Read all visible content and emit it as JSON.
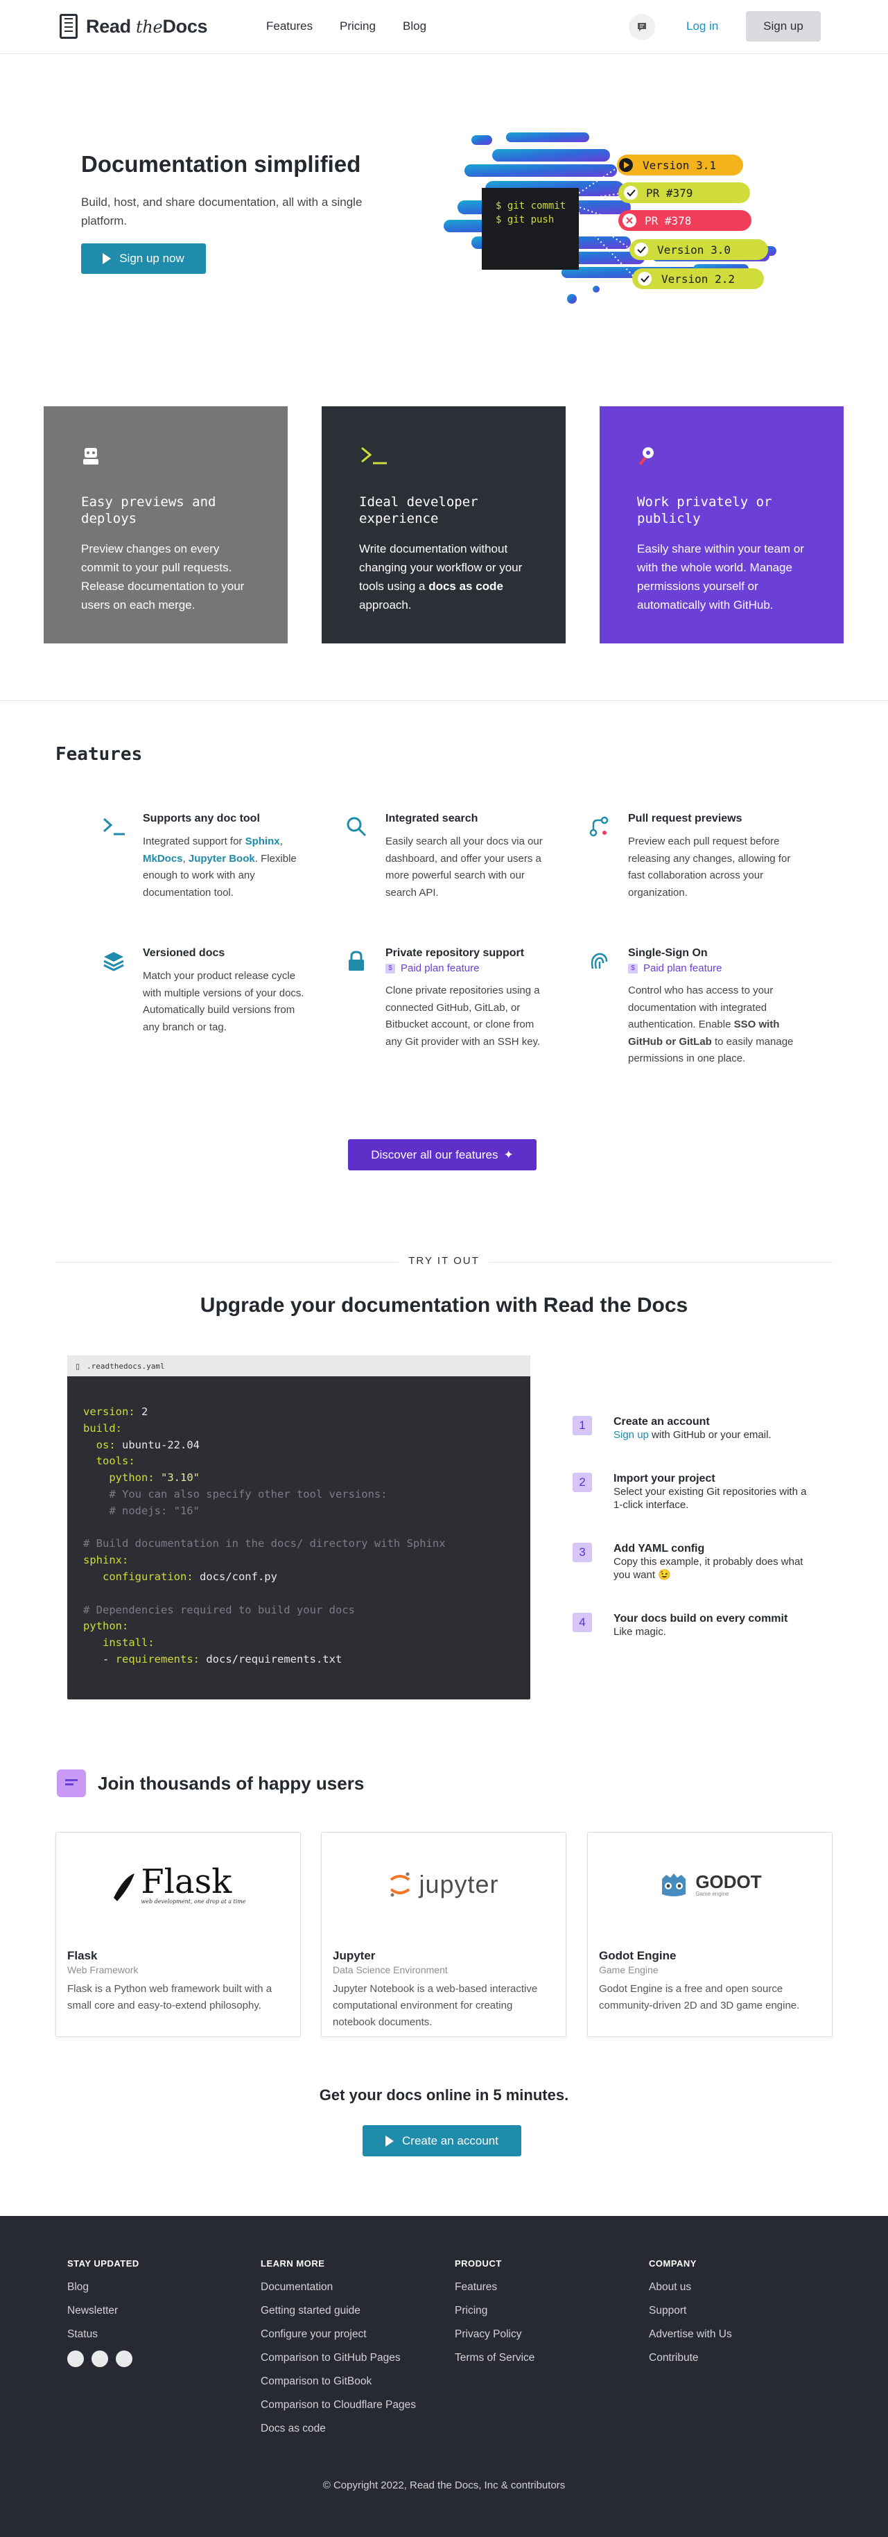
{
  "nav": {
    "brand_main": "Read",
    "brand_the": "the",
    "brand_docs": "Docs",
    "links": [
      "Features",
      "Pricing",
      "Blog"
    ],
    "login": "Log in",
    "signup": "Sign up"
  },
  "hero": {
    "title": "Documentation simplified",
    "subtitle": "Build, host, and share documentation, all with a single platform.",
    "cta": "Sign up now",
    "terminal_lines": [
      "$ git commit",
      "$ git push"
    ],
    "pills": [
      "Version 3.1",
      "PR #379",
      "PR #378",
      "Version 3.0",
      "Version 2.2"
    ]
  },
  "cards": [
    {
      "title": "Easy previews and deploys",
      "text": "Preview changes on every commit to your pull requests. Release documentation to your users on each merge.",
      "color": "#767676",
      "icon": "robot-icon"
    },
    {
      "title": "Ideal developer experience",
      "text_before": "Write documentation without changing your workflow or your tools using a ",
      "text_bold": "docs as code",
      "text_after": " approach.",
      "color": "#2b2f36",
      "icon": "terminal-icon"
    },
    {
      "title": "Work privately or publicly",
      "text": "Easily share within your team or with the whole world. Manage permissions yourself or automatically with GitHub.",
      "color": "#6c3fd7",
      "icon": "key-icon"
    }
  ],
  "features": {
    "heading": "Features",
    "paid_label": "Paid plan feature",
    "items": [
      {
        "title": "Supports any doc tool",
        "text_before": "Integrated support for ",
        "links": [
          "Sphinx",
          "MkDocs",
          "Jupyter Book"
        ],
        "text_after": "Flexible enough to work with any documentation tool.",
        "icon": "terminal-icon"
      },
      {
        "title": "Integrated search",
        "text": "Easily search all your docs via our dashboard, and offer your users a more powerful search with our search API.",
        "icon": "search-icon"
      },
      {
        "title": "Pull request previews",
        "text": "Preview each pull request before releasing any changes, allowing for fast collaboration across your organization.",
        "icon": "pull-request-icon"
      },
      {
        "title": "Versioned docs",
        "text": "Match your product release cycle with multiple versions of your docs. Automatically build versions from any branch or tag.",
        "icon": "layers-icon"
      },
      {
        "title": "Private repository support",
        "text": "Clone private repositories using a connected GitHub, GitLab, or Bitbucket account, or clone from any Git provider with an SSH key.",
        "icon": "lock-icon"
      },
      {
        "title": "Single-Sign On",
        "text_before": "Control who has access to your documentation with integrated authentication. Enable ",
        "text_bold": "SSO with GitHub or GitLab",
        "text_after": " to easily manage permissions in one place.",
        "icon": "fingerprint-icon"
      }
    ],
    "cta": "Discover all our features"
  },
  "tryit": {
    "label": "TRY IT OUT",
    "heading": "Upgrade your documentation with Read the Docs",
    "filename": ".readthedocs.yaml",
    "steps": [
      {
        "num": "1",
        "title": "Create an account",
        "link": "Sign up",
        "text": " with GitHub or your email."
      },
      {
        "num": "2",
        "title": "Import your project",
        "text": "Select your existing Git repositories with a 1-click interface."
      },
      {
        "num": "3",
        "title": "Add YAML config",
        "text": "Copy this example, it probably does what you want 😉"
      },
      {
        "num": "4",
        "title": "Your docs build on every commit",
        "text": "Like magic."
      }
    ]
  },
  "users": {
    "heading": "Join thousands of happy users",
    "items": [
      {
        "name": "Flask",
        "type": "Web Framework",
        "desc": "Flask is a Python web framework built with a small core and easy-to-extend philosophy.",
        "logo": "Flask",
        "logo_sub": "web development, one drop at a time"
      },
      {
        "name": "Jupyter",
        "type": "Data Science Environment",
        "desc": "Jupyter Notebook is a web-based interactive computational environment for creating notebook documents.",
        "logo": "jupyter"
      },
      {
        "name": "Godot Engine",
        "type": "Game Engine",
        "desc": "Godot Engine is a free and open source community-driven 2D and 3D game engine.",
        "logo": "GODOT",
        "logo_sub": "Game engine"
      }
    ]
  },
  "cta": {
    "heading": "Get your docs online in 5 minutes.",
    "button": "Create an account"
  },
  "footer": {
    "columns": [
      {
        "heading": "STAY UPDATED",
        "links": [
          "Blog",
          "Newsletter",
          "Status"
        ]
      },
      {
        "heading": "LEARN MORE",
        "links": [
          "Documentation",
          "Getting started guide",
          "Configure your project",
          "Comparison to GitHub Pages",
          "Comparison to GitBook",
          "Comparison to Cloudflare Pages",
          "Docs as code"
        ]
      },
      {
        "heading": "PRODUCT",
        "links": [
          "Features",
          "Pricing",
          "Privacy Policy",
          "Terms of Service"
        ]
      },
      {
        "heading": "COMPANY",
        "links": [
          "About us",
          "Support",
          "Advertise with Us",
          "Contribute"
        ]
      }
    ],
    "copyright": "Copyright 2022, Read the Docs, Inc & contributors"
  }
}
